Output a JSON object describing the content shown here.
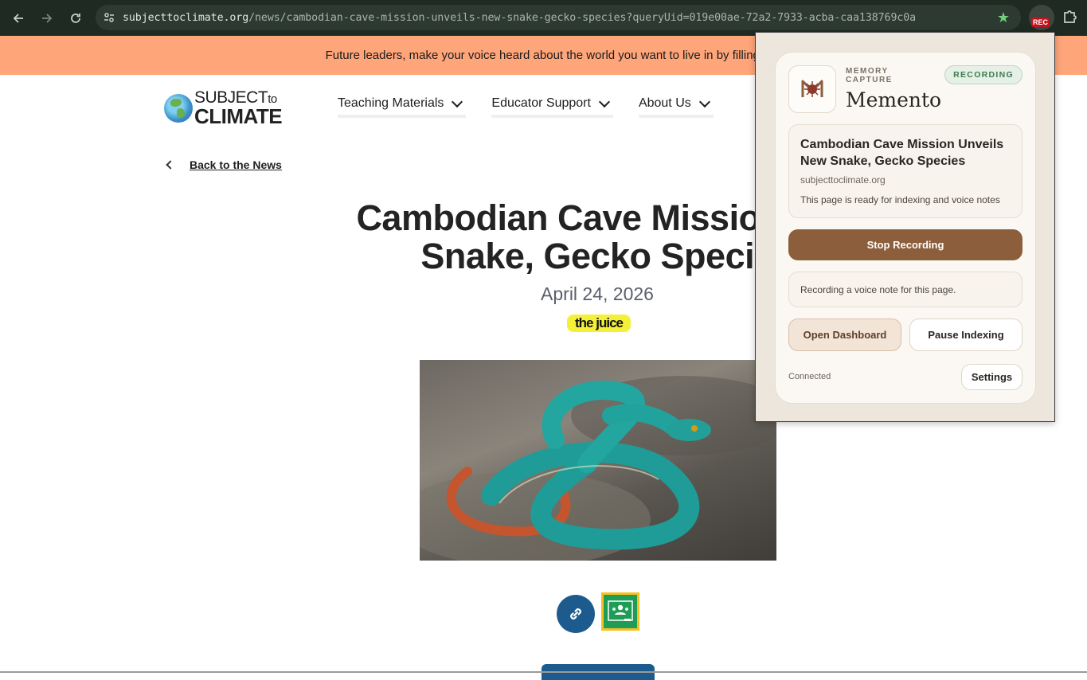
{
  "browser": {
    "url_host": "subjecttoclimate.org",
    "url_path": "/news/cambodian-cave-mission-unveils-new-snake-gecko-species?queryUid=019e00ae-72a2-7933-acba-caa138769c0a",
    "rec_badge": "REC",
    "icons": [
      "back-arrow-icon",
      "forward-arrow-icon",
      "reload-icon",
      "site-info-icon",
      "bookmark-star-icon",
      "extension-puzzle-icon"
    ]
  },
  "banner": {
    "text": "Future leaders, make your voice heard about the world you want to live in by filling o"
  },
  "site": {
    "logo_top": "SUBJECT",
    "logo_to": "to",
    "logo_bottom": "CLIMATE",
    "nav": [
      {
        "label": "Teaching Materials"
      },
      {
        "label": "Educator Support"
      },
      {
        "label": "About Us"
      }
    ],
    "back_label": "Back to the News"
  },
  "article": {
    "title_line1": "Cambodian Cave Mission Un",
    "title_line2": "Snake, Gecko Specie",
    "date": "April 24, 2026",
    "source_badge": "the juice"
  },
  "popup": {
    "label": "MEMORY CAPTURE",
    "brand": "Memento",
    "status_pill": "RECORDING",
    "page_title": "Cambodian Cave Mission Unveils New Snake, Gecko Species",
    "page_domain": "subjecttoclimate.org",
    "page_status": "This page is ready for indexing and voice notes",
    "stop_button": "Stop Recording",
    "note_text": "Recording a voice note for this page.",
    "open_dashboard": "Open Dashboard",
    "pause_indexing": "Pause Indexing",
    "connection": "Connected",
    "settings": "Settings",
    "colors": {
      "accent": "#8c5e3c",
      "pill_green": "#3e7a4d"
    }
  }
}
